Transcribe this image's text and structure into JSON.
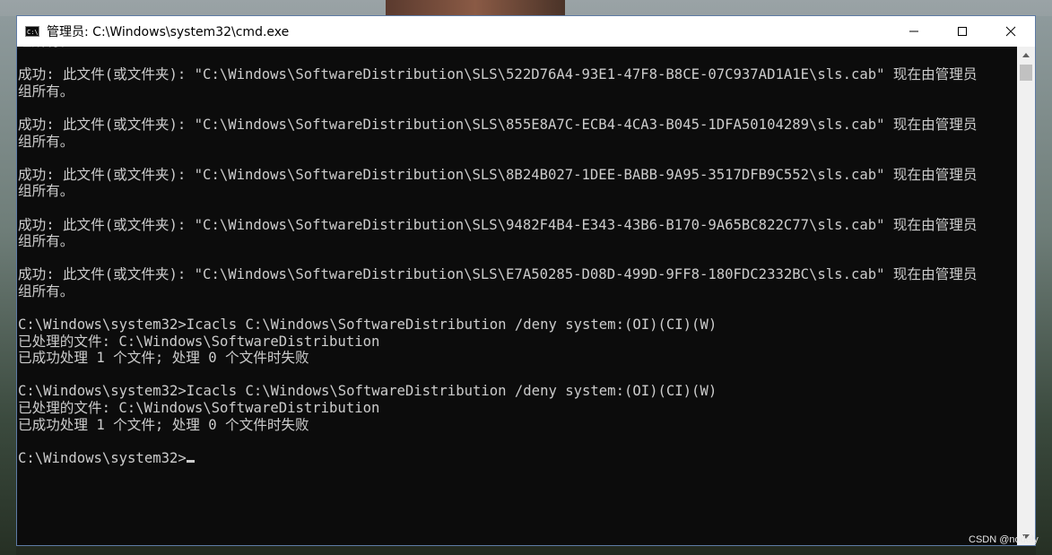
{
  "window": {
    "title": "管理员: C:\\Windows\\system32\\cmd.exe",
    "app_icon_text": "C:\\",
    "controls": [
      "minimize-icon",
      "maximize-icon",
      "close-icon"
    ]
  },
  "console": {
    "lines": [
      "组所有。",
      "",
      "成功: 此文件(或文件夹): \"C:\\Windows\\SoftwareDistribution\\SLS\\522D76A4-93E1-47F8-B8CE-07C937AD1A1E\\sls.cab\" 现在由管理员",
      "组所有。",
      "",
      "成功: 此文件(或文件夹): \"C:\\Windows\\SoftwareDistribution\\SLS\\855E8A7C-ECB4-4CA3-B045-1DFA50104289\\sls.cab\" 现在由管理员",
      "组所有。",
      "",
      "成功: 此文件(或文件夹): \"C:\\Windows\\SoftwareDistribution\\SLS\\8B24B027-1DEE-BABB-9A95-3517DFB9C552\\sls.cab\" 现在由管理员",
      "组所有。",
      "",
      "成功: 此文件(或文件夹): \"C:\\Windows\\SoftwareDistribution\\SLS\\9482F4B4-E343-43B6-B170-9A65BC822C77\\sls.cab\" 现在由管理员",
      "组所有。",
      "",
      "成功: 此文件(或文件夹): \"C:\\Windows\\SoftwareDistribution\\SLS\\E7A50285-D08D-499D-9FF8-180FDC2332BC\\sls.cab\" 现在由管理员",
      "组所有。",
      "",
      "C:\\Windows\\system32>Icacls C:\\Windows\\SoftwareDistribution /deny system:(OI)(CI)(W)",
      "已处理的文件: C:\\Windows\\SoftwareDistribution",
      "已成功处理 1 个文件; 处理 0 个文件时失败",
      "",
      "C:\\Windows\\system32>Icacls C:\\Windows\\SoftwareDistribution /deny system:(OI)(CI)(W)",
      "已处理的文件: C:\\Windows\\SoftwareDistribution",
      "已成功处理 1 个文件; 处理 0 个文件时失败",
      ""
    ],
    "prompt": "C:\\Windows\\system32>"
  },
  "colors": {
    "console_bg": "#0c0c0c",
    "console_fg": "#cccccc",
    "titlebar_bg": "#ffffff"
  },
  "watermark": "CSDN @nodely"
}
